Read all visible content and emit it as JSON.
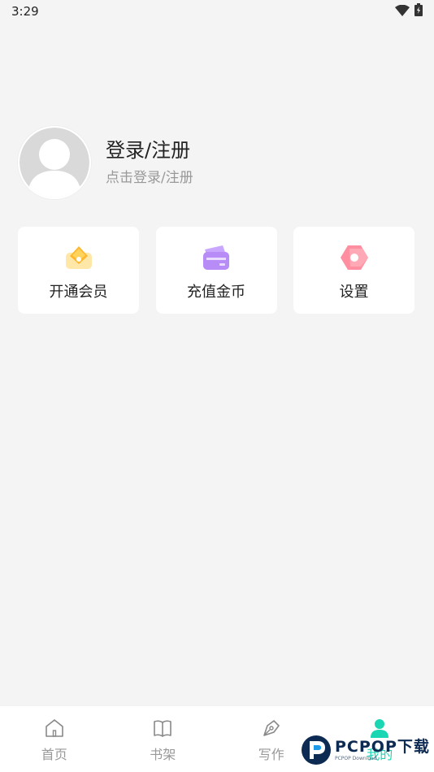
{
  "status_bar": {
    "time": "3:29",
    "icons": [
      "wifi-icon",
      "battery-icon"
    ]
  },
  "profile": {
    "title": "登录/注册",
    "subtitle": "点击登录/注册",
    "avatar_icon": "default-avatar-icon"
  },
  "quick_actions": [
    {
      "label": "开通会员",
      "icon": "vip-crown-icon"
    },
    {
      "label": "充值金币",
      "icon": "recharge-card-icon"
    },
    {
      "label": "设置",
      "icon": "settings-gear-icon"
    }
  ],
  "tab_bar": {
    "active_color": "#1ad6b3",
    "inactive_color": "#999999",
    "tabs": [
      {
        "label": "首页",
        "icon": "home-icon",
        "active": false
      },
      {
        "label": "书架",
        "icon": "book-icon",
        "active": false
      },
      {
        "label": "写作",
        "icon": "pen-icon",
        "active": false
      },
      {
        "label": "我的",
        "icon": "user-icon",
        "active": true
      }
    ]
  },
  "watermark": {
    "main": "PCPOP下载",
    "sub": "PCPOP Download"
  }
}
